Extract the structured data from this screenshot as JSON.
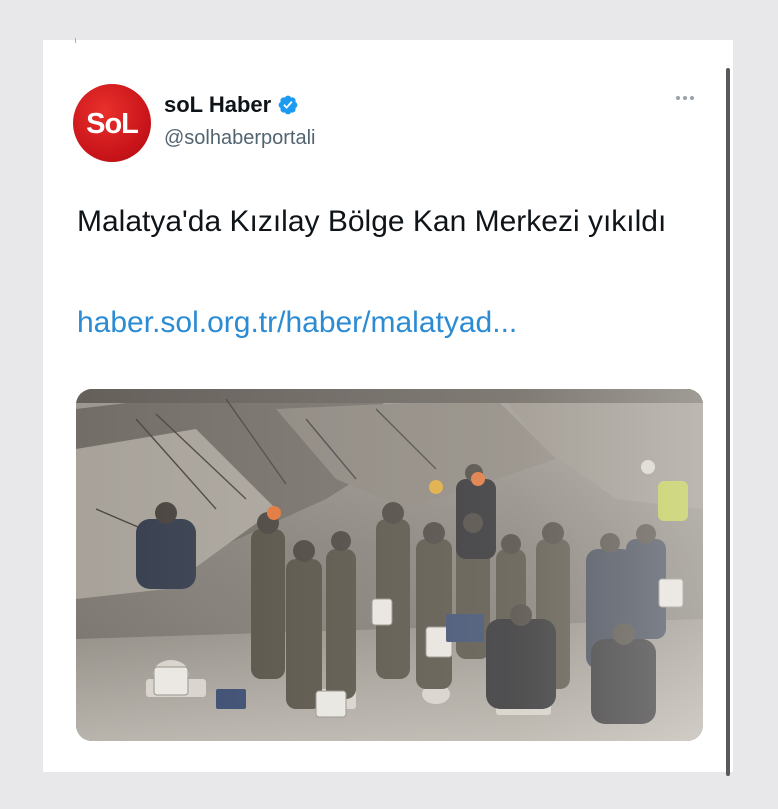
{
  "tweet": {
    "avatar_text": "SoL",
    "display_name": "soL Haber",
    "handle": "@solhaberportali",
    "text": "Malatya'da Kızılay Bölge Kan Merkezi yıkıldı",
    "link_text": "haber.sol.org.tr/haber/malatyad..."
  },
  "colors": {
    "avatar_red": "#c8141a",
    "verified_blue": "#1d9bf0",
    "link_blue": "#2b8bd3",
    "text_primary": "#0f1419",
    "text_secondary": "#536471"
  },
  "icons": {
    "verified": "verified-badge-icon",
    "more": "more-options-icon"
  }
}
